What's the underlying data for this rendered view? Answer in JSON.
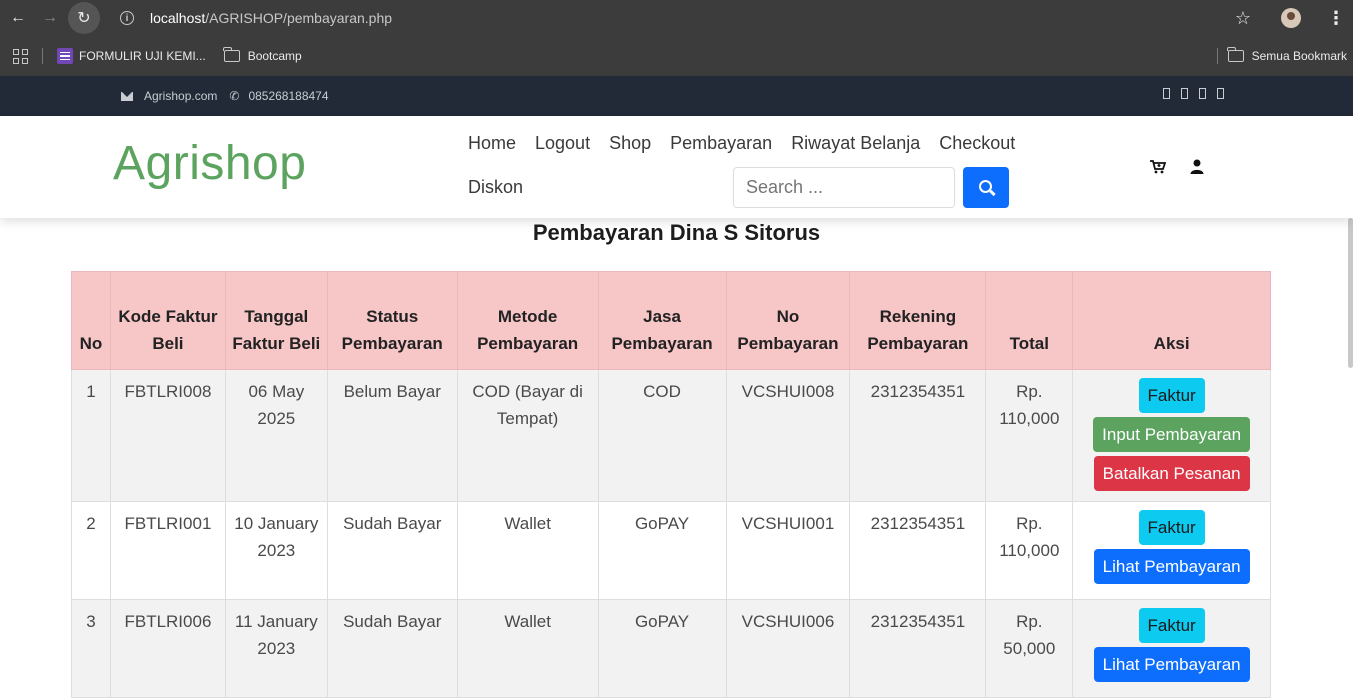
{
  "browser": {
    "url_host": "localhost",
    "url_path": "/AGRISHOP/pembayaran.php",
    "bookmarks": [
      "FORMULIR UJI KEMI...",
      "Bootcamp"
    ],
    "bookmarks_right": "Semua Bookmark"
  },
  "topbar": {
    "email": "Agrishop.com",
    "phone": "085268188474"
  },
  "header": {
    "logo": "Agrishop",
    "nav": [
      "Home",
      "Logout",
      "Shop",
      "Pembayaran",
      "Riwayat Belanja",
      "Checkout"
    ],
    "nav_second": "Diskon",
    "search_placeholder": "Search ..."
  },
  "page": {
    "title": "Pembayaran Dina S Sitorus"
  },
  "table": {
    "headers": [
      "No",
      "Kode Faktur Beli",
      "Tanggal Faktur Beli",
      "Status Pembayaran",
      "Metode Pembayaran",
      "Jasa Pembayaran",
      "No Pembayaran",
      "Rekening Pembayaran",
      "Total",
      "Aksi"
    ],
    "rows": [
      {
        "no": "1",
        "kode": "FBTLRI008",
        "tanggal": "06 May 2025",
        "status": "Belum Bayar",
        "metode": "COD (Bayar di Tempat)",
        "jasa": "COD",
        "no_pembayaran": "VCSHUI008",
        "rekening": "2312354351",
        "total": "Rp. 110,000",
        "actions": [
          "Faktur",
          "Input Pembayaran",
          "Batalkan Pesanan"
        ]
      },
      {
        "no": "2",
        "kode": "FBTLRI001",
        "tanggal": "10 January 2023",
        "status": "Sudah Bayar",
        "metode": "Wallet",
        "jasa": "GoPAY",
        "no_pembayaran": "VCSHUI001",
        "rekening": "2312354351",
        "total": "Rp. 110,000",
        "actions": [
          "Faktur",
          "Lihat Pembayaran"
        ]
      },
      {
        "no": "3",
        "kode": "FBTLRI006",
        "tanggal": "11 January 2023",
        "status": "Sudah Bayar",
        "metode": "Wallet",
        "jasa": "GoPAY",
        "no_pembayaran": "VCSHUI006",
        "rekening": "2312354351",
        "total": "Rp. 50,000",
        "actions": [
          "Faktur",
          "Lihat Pembayaran"
        ]
      }
    ]
  },
  "colors": {
    "brand_green": "#5ba35f",
    "header_pink": "#f7c6c7",
    "primary": "#0d6efd",
    "info": "#0dcaf0",
    "danger": "#dc3545",
    "topbar": "#212a36"
  }
}
